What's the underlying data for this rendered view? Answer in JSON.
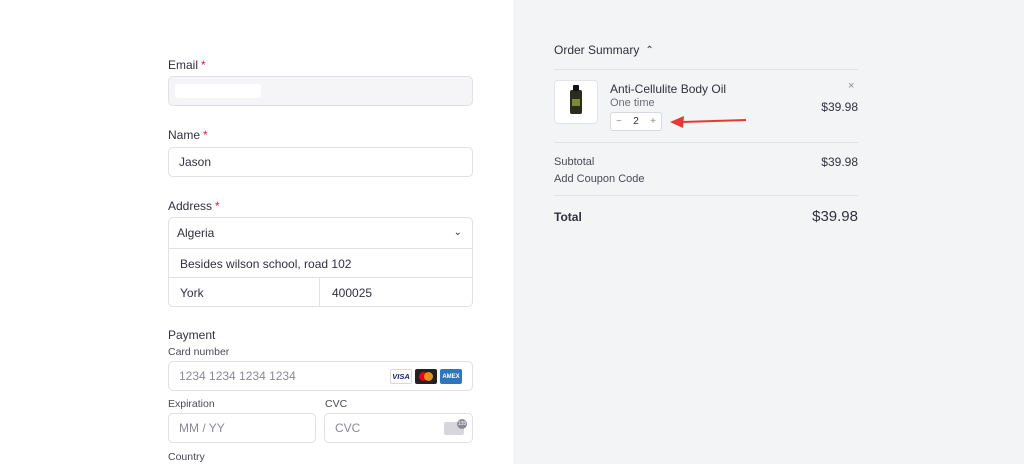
{
  "form": {
    "email": {
      "label": "Email",
      "required_mark": "*"
    },
    "name": {
      "label": "Name",
      "required_mark": "*",
      "value": "Jason"
    },
    "address": {
      "label": "Address",
      "required_mark": "*",
      "country": "Algeria",
      "street": "Besides wilson school, road 102",
      "city": "York",
      "zip": "400025"
    },
    "payment": {
      "heading": "Payment",
      "card_number_label": "Card number",
      "card_number_placeholder": "1234 1234 1234 1234",
      "expiration_label": "Expiration",
      "expiration_placeholder": "MM / YY",
      "cvc_label": "CVC",
      "cvc_placeholder": "CVC",
      "country_label": "Country",
      "card_brands": [
        "VISA",
        "mastercard",
        "AMEX"
      ]
    }
  },
  "summary": {
    "heading": "Order Summary",
    "item": {
      "name": "Anti-Cellulite Body Oil",
      "frequency": "One time",
      "quantity": "2",
      "price": "$39.98",
      "minus": "−",
      "plus": "+",
      "remove": "×"
    },
    "subtotal_label": "Subtotal",
    "subtotal_value": "$39.98",
    "coupon_label": "Add Coupon Code",
    "total_label": "Total",
    "total_value": "$39.98"
  },
  "colors": {
    "required": "#df1b41",
    "arrow": "#e53935",
    "summary_bg": "#f3f4f6"
  }
}
